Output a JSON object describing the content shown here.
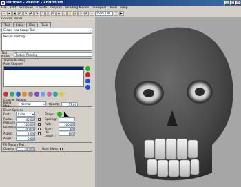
{
  "window": {
    "title": "Untitled - ZBrush - ZbrushTM"
  },
  "menu": [
    "File",
    "Edit",
    "Windows",
    "Create",
    "Display",
    "Shading Modes",
    "Viewport",
    "Tools",
    "Help"
  ],
  "toolbar": {
    "zoom_value": "zoom 100"
  },
  "panel": {
    "title": "Control Panel",
    "tabs": [
      "Tool",
      "Color",
      "Files",
      "Tools"
    ],
    "tool_select": "Create new Sculpt Tool",
    "tool_list": [
      "Texture Painting"
    ],
    "tool_name_label": "Tool Name",
    "tool_name_value": "Texture Painting"
  },
  "texture_painting": {
    "header": "Texture Painting",
    "paint_channel_label": "Paint Channel",
    "channel_options": "Channel Options",
    "blend_mode_label": "Blend Mode :",
    "blend_mode": "Normal",
    "opacity_label": "Opacity :",
    "opacity": "57.00"
  },
  "brush": {
    "header": "Brush Options",
    "rows": [
      {
        "l": "Font :",
        "v": "Cube",
        "l2": "Shape :",
        "v2": ""
      },
      {
        "l": "Radius :",
        "v": "45.00",
        "l2": "Spacing :",
        "v2": ""
      },
      {
        "l": "Pressure :",
        "v": "100.00",
        "l2": "Fade :",
        "v2": "100.00"
      },
      {
        "l": "Hardness :",
        "v": "100.00",
        "l2": "Jitter :",
        "v2": "64"
      },
      {
        "l": "Aspect :",
        "v": "1.00",
        "l2": "Hit Length :",
        "v2": "100"
      },
      {
        "l": "Angle :",
        "v": "0.00",
        "l2": "",
        "v2": ""
      }
    ]
  },
  "fill": {
    "header": "Fill Texture Tool",
    "opacity_label": "Opacity :",
    "opacity": "100.00",
    "hard_edges_label": "Hard Edges :"
  },
  "colors": {
    "accent": "#0a246a",
    "green": "#2bb02b",
    "red": "#d02020",
    "blue": "#2050d0"
  }
}
